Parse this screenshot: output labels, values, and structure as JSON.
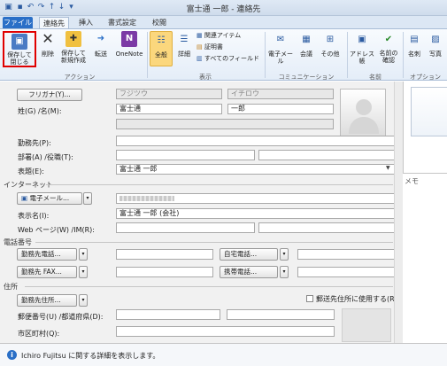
{
  "window": {
    "title": "富士通 一郎 - 連絡先"
  },
  "tabs": [
    "ファイル",
    "連絡先",
    "挿入",
    "書式設定",
    "校閲"
  ],
  "ribbon": {
    "save_close": "保存して\n閉じる",
    "delete": "削除",
    "save_new": "保存して\n新規作成",
    "forward": "転送",
    "onenote": "OneNote",
    "general": "全般",
    "details": "詳細",
    "activities": "関連アイテム",
    "certificates": "証明書",
    "all_fields": "すべてのフィールド",
    "email": "電子メール",
    "meeting": "会議",
    "more": "その他",
    "address_book": "アドレス帳",
    "check_names": "名前の\n確認",
    "business_card": "名刺",
    "picture": "写真",
    "groups": {
      "actions": "アクション",
      "show": "表示",
      "communicate": "コミュニケーション",
      "names": "名前",
      "options": "オプション"
    }
  },
  "form": {
    "furigana_btn": "フリガナ(Y)...",
    "furigana_last": "フジツウ",
    "furigana_first": "イチロウ",
    "name_label": "姓(G) /名(M):",
    "last_name": "富士通",
    "first_name": "一郎",
    "company_label": "勤務先(P):",
    "dept_label": "部署(A) /役職(T):",
    "display_as_label": "表題(E):",
    "display_as": "富士通 一郎",
    "internet_section": "インターネット",
    "email_btn": "電子メール...",
    "display_name_label": "表示名(I):",
    "display_name": "富士通 一郎 (会社)",
    "web_label": "Web ページ(W) /IM(R):",
    "phone_section": "電話番号",
    "business_phone_btn": "勤務先電話...",
    "home_phone_btn": "自宅電話...",
    "business_fax_btn": "勤務先 FAX...",
    "mobile_btn": "携帯電話...",
    "address_section": "住所",
    "business_addr_btn": "勤務先住所...",
    "mailing_checkbox": "郵送先住所に使用する(R)",
    "postal_label": "郵便番号(U) /都道府県(D):",
    "city_label": "市区町村(Q):"
  },
  "memo": {
    "label": "メモ"
  },
  "status": {
    "text": "Ichiro Fujitsu に関する詳細を表示します。"
  }
}
